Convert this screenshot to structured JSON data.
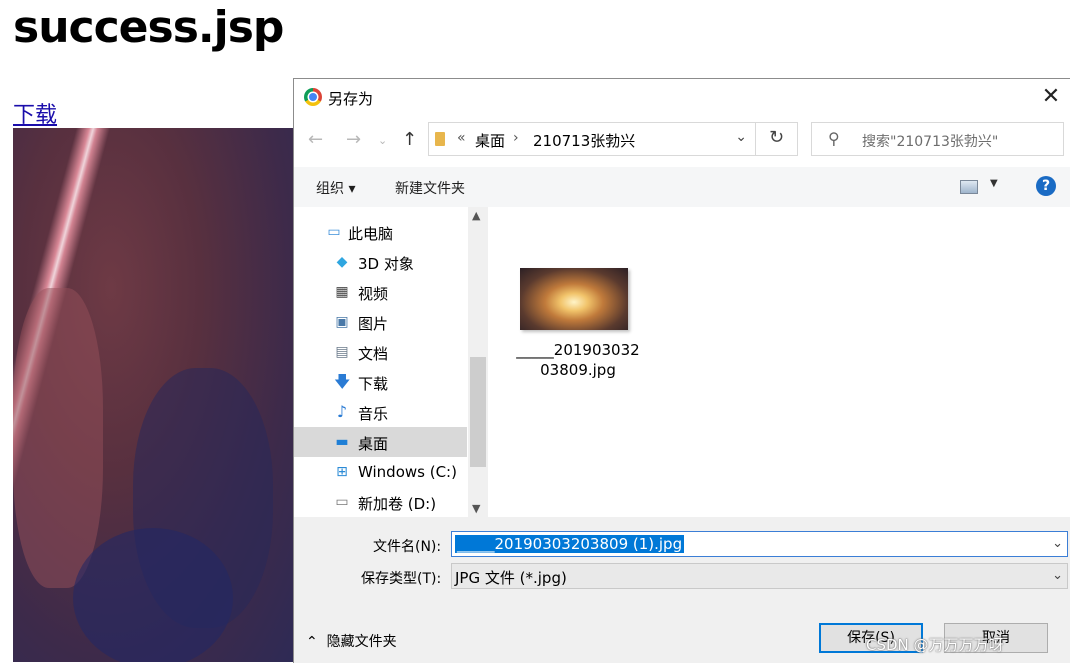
{
  "page": {
    "title": "success.jsp",
    "download_link": "下载"
  },
  "dialog": {
    "title": "另存为",
    "close": "✕",
    "address": {
      "prefix": "«",
      "crumbs": [
        "桌面",
        "210713张勃兴"
      ]
    },
    "search_placeholder": "搜索\"210713张勃兴\"",
    "toolbar": {
      "organize": "组织 ▾",
      "new_folder": "新建文件夹",
      "help": "?"
    },
    "nav_items": [
      {
        "label": "此电脑",
        "icon": "computer-icon"
      },
      {
        "label": "3D 对象",
        "icon": "cube-icon"
      },
      {
        "label": "视频",
        "icon": "film-icon"
      },
      {
        "label": "图片",
        "icon": "picture-icon"
      },
      {
        "label": "文档",
        "icon": "document-icon"
      },
      {
        "label": "下载",
        "icon": "download-arrow-icon"
      },
      {
        "label": "音乐",
        "icon": "music-note-icon"
      },
      {
        "label": "桌面",
        "icon": "desktop-icon",
        "selected": true
      },
      {
        "label": "Windows (C:)",
        "icon": "windows-drive-icon"
      },
      {
        "label": "新加卷 (D:)",
        "icon": "drive-icon"
      }
    ],
    "file": {
      "name_line1": "_____201903032",
      "name_line2": "03809.jpg"
    },
    "filename_label": "文件名(N):",
    "filename_value": "_____20190303203809 (1).jpg",
    "filetype_label": "保存类型(T):",
    "filetype_value": "JPG 文件 (*.jpg)",
    "hide_folders": "隐藏文件夹",
    "save_button": "保存(S)",
    "cancel_button": "取消"
  },
  "watermark": "CSDN @万万万万呀"
}
